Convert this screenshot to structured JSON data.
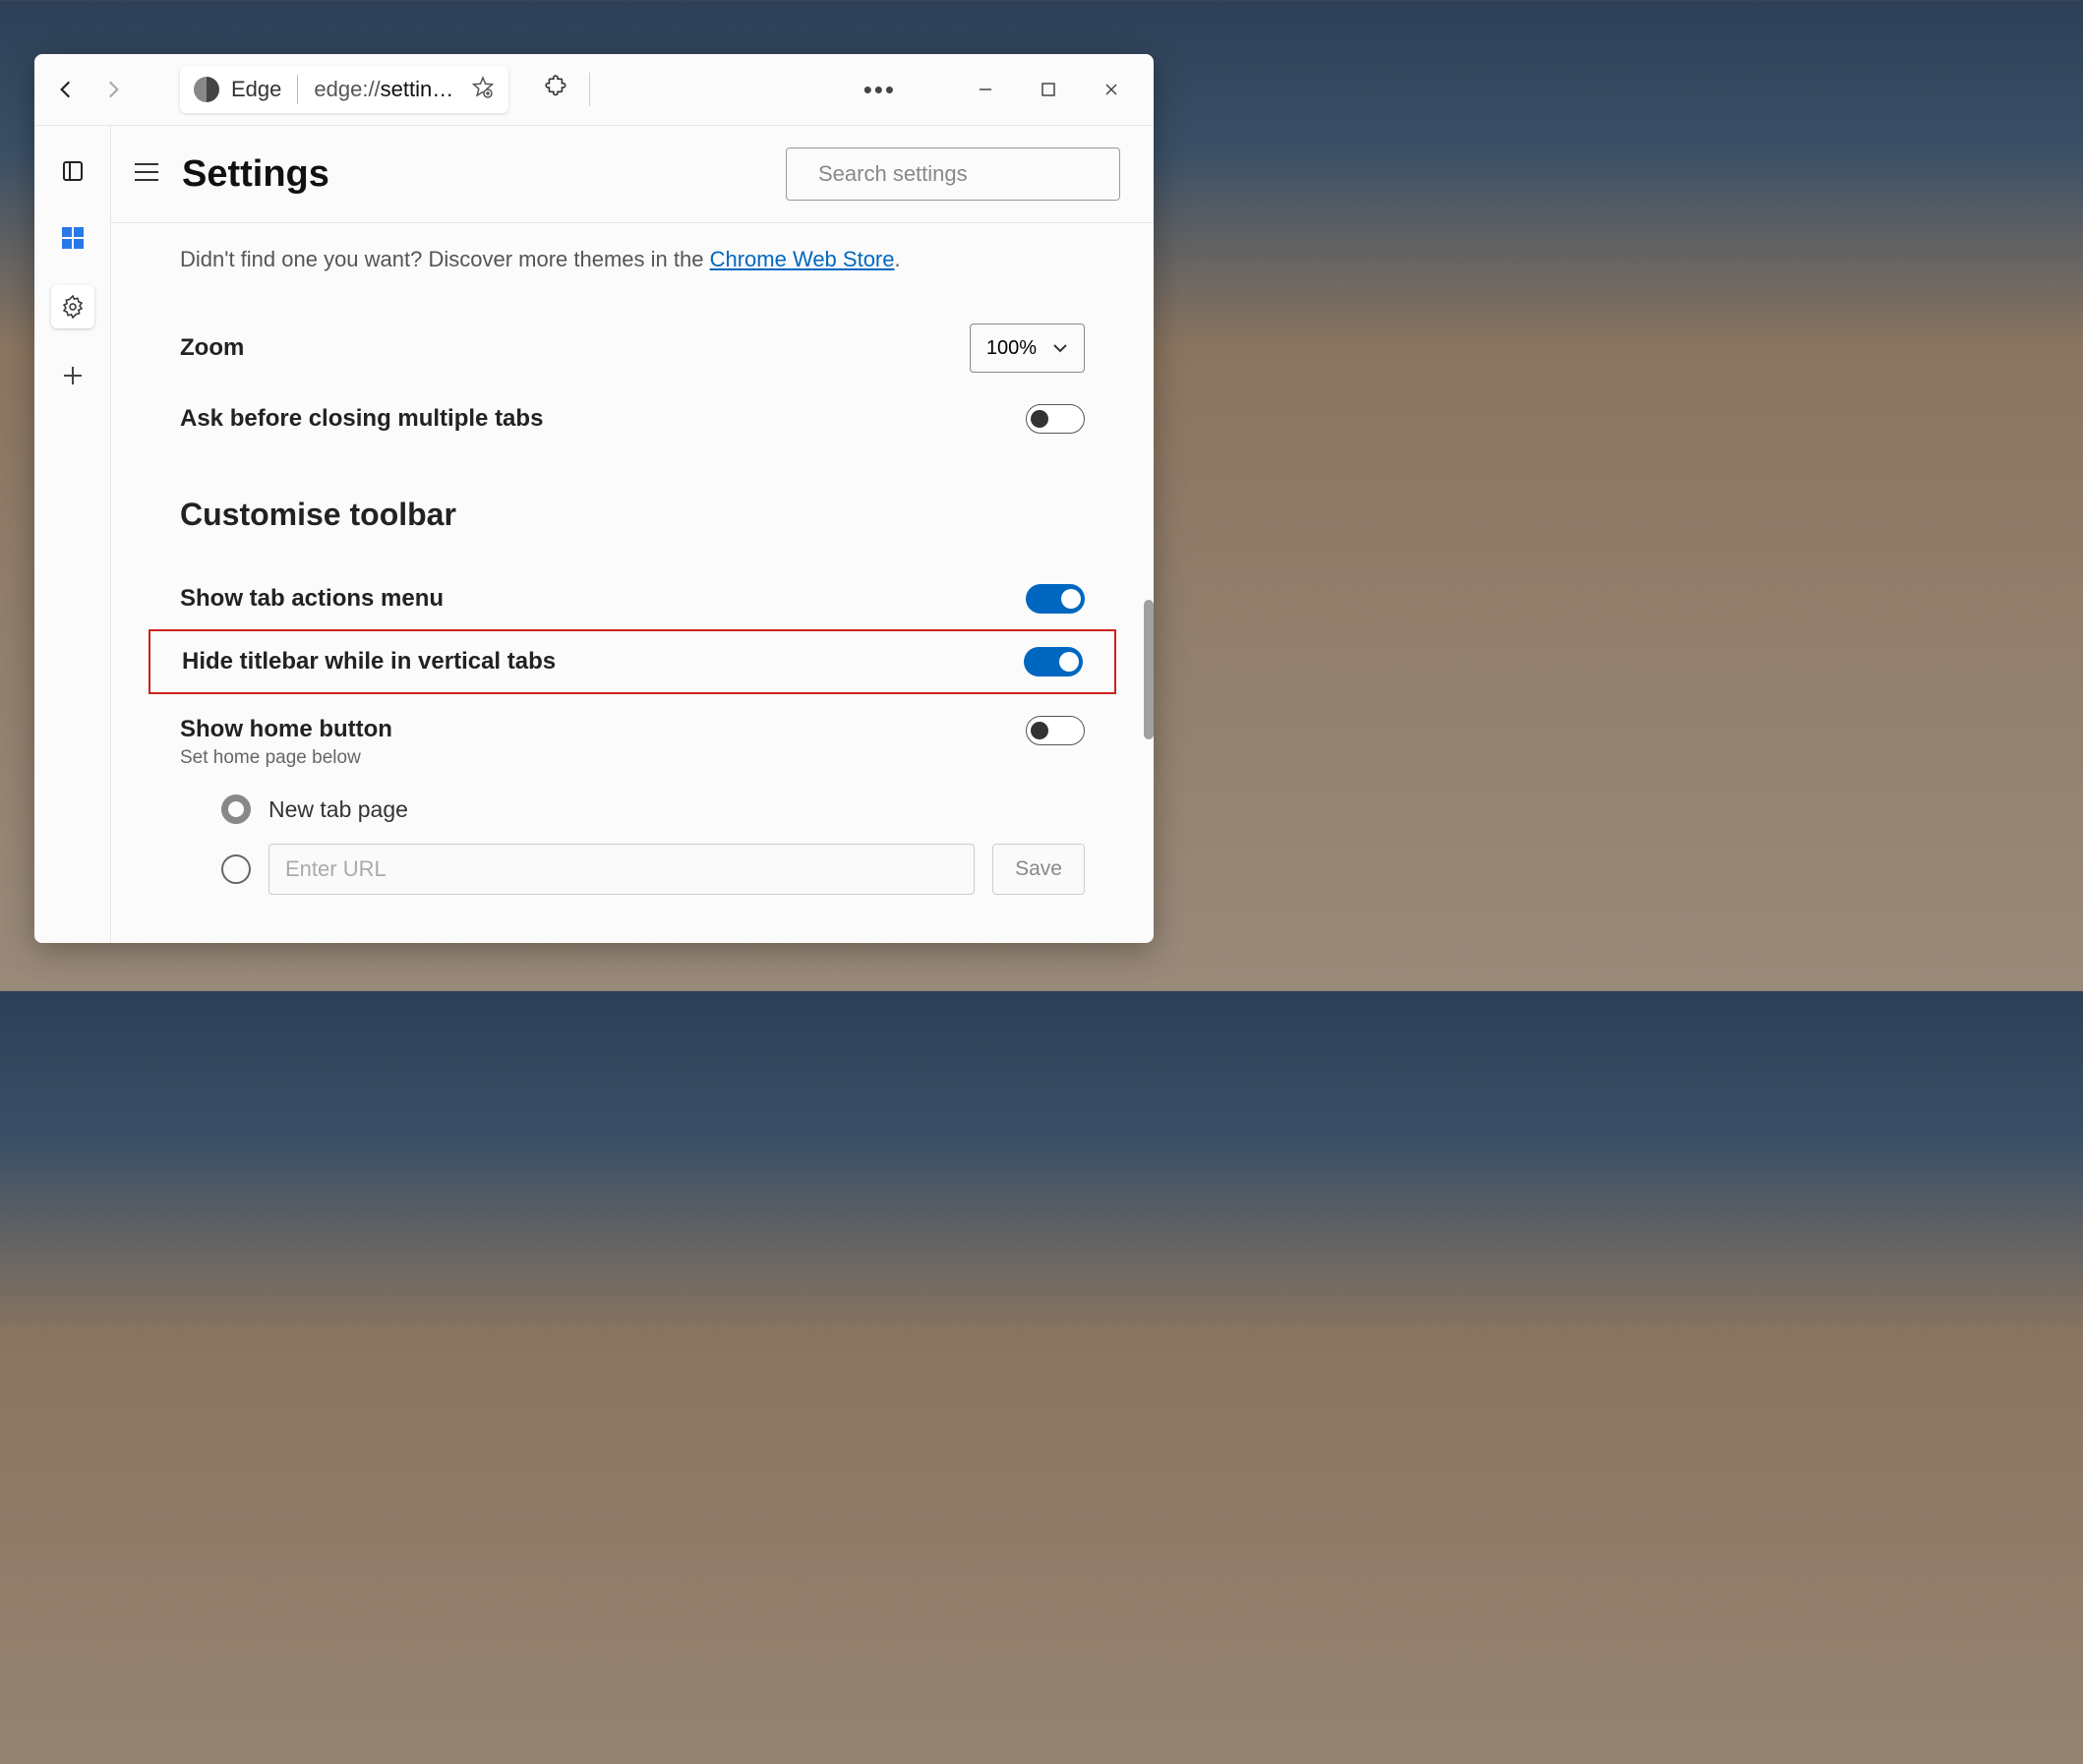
{
  "titlebar": {
    "tab_title": "Edge",
    "tab_url_scheme": "edge://",
    "tab_url_path": "settin…"
  },
  "header": {
    "title": "Settings",
    "search_placeholder": "Search settings"
  },
  "hint": {
    "prefix": "Didn't find one you want? Discover more themes in the ",
    "link": "Chrome Web Store",
    "suffix": "."
  },
  "zoom": {
    "label": "Zoom",
    "value": "100%"
  },
  "ask_close": {
    "label": "Ask before closing multiple tabs",
    "on": false
  },
  "section_customise": "Customise toolbar",
  "tab_actions": {
    "label": "Show tab actions menu",
    "on": true
  },
  "hide_titlebar": {
    "label": "Hide titlebar while in vertical tabs",
    "on": true
  },
  "home_button": {
    "label": "Show home button",
    "sub": "Set home page below",
    "on": false
  },
  "radio_newtab": "New tab page",
  "url_placeholder": "Enter URL",
  "save_label": "Save"
}
